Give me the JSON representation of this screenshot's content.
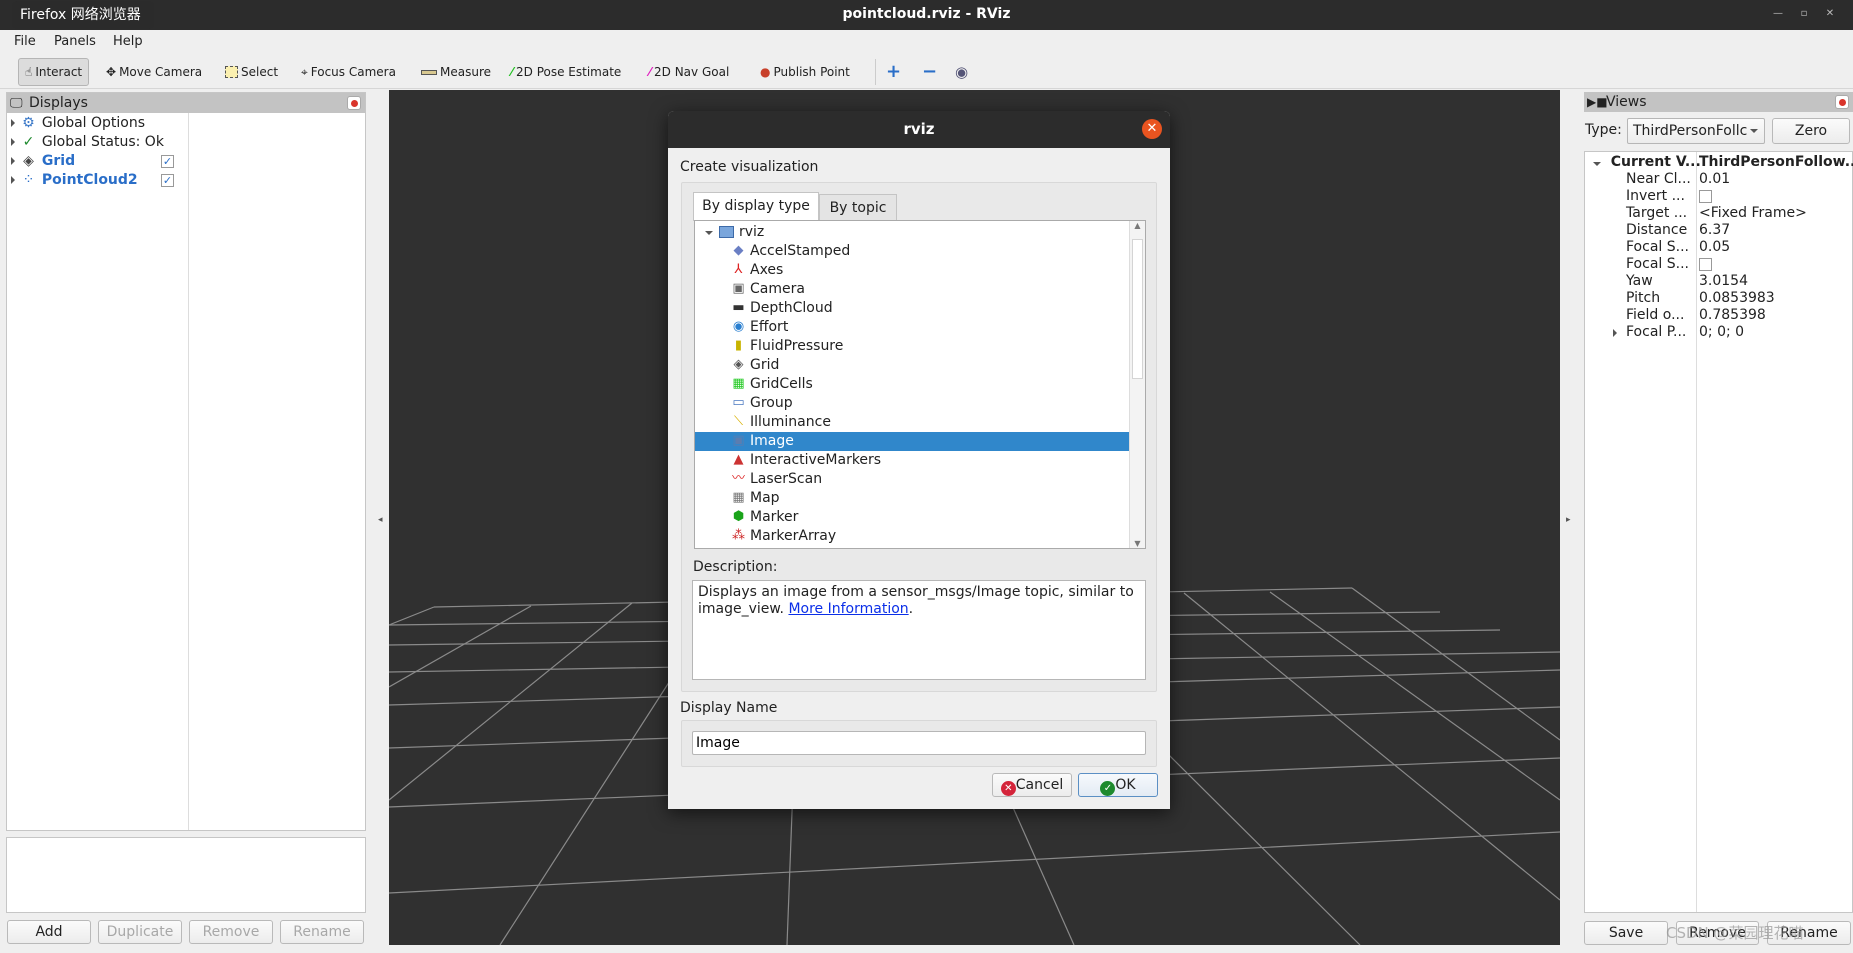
{
  "window": {
    "title": "pointcloud.rviz - RViz",
    "tooltip": "Firefox 网络浏览器"
  },
  "menu": [
    "File",
    "Panels",
    "Help"
  ],
  "toolbar": {
    "tools": [
      {
        "label": "Interact",
        "icon": "hand-icon",
        "active": true
      },
      {
        "label": "Move Camera",
        "icon": "move-camera-icon"
      },
      {
        "label": "Select",
        "icon": "select-icon"
      },
      {
        "label": "Focus Camera",
        "icon": "focus-camera-icon"
      },
      {
        "label": "Measure",
        "icon": "ruler-icon"
      },
      {
        "label": "2D Pose Estimate",
        "icon": "green-arrow-icon"
      },
      {
        "label": "2D Nav Goal",
        "icon": "magenta-arrow-icon"
      },
      {
        "label": "Publish Point",
        "icon": "map-pin-icon"
      }
    ],
    "add": "+",
    "remove": "−",
    "eye": "◉"
  },
  "displays": {
    "title": "Displays",
    "items": [
      {
        "label": "Global Options",
        "icon": "gear-icon",
        "color": "#222222"
      },
      {
        "label": "Global Status: Ok",
        "icon": "check-icon",
        "color": "#222222"
      },
      {
        "label": "Grid",
        "icon": "grid-icon",
        "color": "#2a6ec8",
        "checked": true
      },
      {
        "label": "PointCloud2",
        "icon": "pointcloud-icon",
        "color": "#2a6ec8",
        "checked": true
      }
    ],
    "buttons": {
      "add": "Add",
      "duplicate": "Duplicate",
      "remove": "Remove",
      "rename": "Rename"
    }
  },
  "views": {
    "title": "Views",
    "type_label": "Type:",
    "type_value": "ThirdPersonFollc",
    "zero": "Zero",
    "header": {
      "label": "Current V...",
      "value": "ThirdPersonFollow..."
    },
    "props": [
      {
        "label": "Near Cl...",
        "value": "0.01"
      },
      {
        "label": "Invert ...",
        "value": "",
        "checkbox": true
      },
      {
        "label": "Target ...",
        "value": "<Fixed Frame>"
      },
      {
        "label": "Distance",
        "value": "6.37"
      },
      {
        "label": "Focal S...",
        "value": "0.05"
      },
      {
        "label": "Focal S...",
        "value": "",
        "checkbox": true
      },
      {
        "label": "Yaw",
        "value": "3.0154"
      },
      {
        "label": "Pitch",
        "value": "0.0853983"
      },
      {
        "label": "Field o...",
        "value": "0.785398"
      },
      {
        "label": "Focal P...",
        "value": "0; 0; 0",
        "expandable": true
      }
    ],
    "buttons": {
      "save": "Save",
      "remove": "Remove",
      "rename": "Rename"
    }
  },
  "dialog": {
    "title": "rviz",
    "heading": "Create visualization",
    "tabs": [
      "By display type",
      "By topic"
    ],
    "root": "rviz",
    "items": [
      "AccelStamped",
      "Axes",
      "Camera",
      "DepthCloud",
      "Effort",
      "FluidPressure",
      "Grid",
      "GridCells",
      "Group",
      "Illuminance",
      "Image",
      "InteractiveMarkers",
      "LaserScan",
      "Map",
      "Marker",
      "MarkerArray"
    ],
    "selected": "Image",
    "description_label": "Description:",
    "description": "Displays an image from a sensor_msgs/Image topic, similar to image_view.",
    "more_info": "More Information",
    "name_label": "Display Name",
    "name_value": "Image",
    "cancel": "Cancel",
    "ok": "OK"
  },
  "watermark": "CSDN @菜园理花喵",
  "colors": {
    "accent": "#3087cb",
    "titlebar": "#2c2c2c",
    "viewport": "#303030",
    "close": "#e95420"
  }
}
